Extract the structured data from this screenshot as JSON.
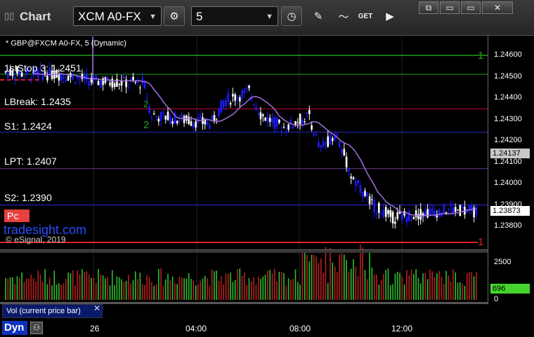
{
  "window": {
    "title": "Chart",
    "minimize_glyph": "⧉",
    "restore_glyph": "▭",
    "close_glyph": "✕"
  },
  "toolbar": {
    "symbol": "XCM A0-FX",
    "interval": "5",
    "get_label": "GET",
    "icons": [
      "gear-icon",
      "clock-icon",
      "pencil-icon",
      "chart-style-icon",
      "get-data-icon",
      "play-icon"
    ]
  },
  "chart": {
    "header": "* GBP@FXCM A0-FX, 5 (Dynamic)",
    "levels": [
      {
        "label": "1stStop 3: 1.2451",
        "price": 1.2451
      },
      {
        "label": "LBreak: 1.2435",
        "price": 1.2435
      },
      {
        "label": "S1: 1.2424",
        "price": 1.2424
      },
      {
        "label": "LPT: 1.2407",
        "price": 1.2407
      },
      {
        "label": "S2: 1.2390",
        "price": 1.239
      }
    ],
    "pc_label": "Pc",
    "watermark": "tradesight.com",
    "copyright": "© eSignal, 2019",
    "marker_1_top": "1",
    "marker_1_bottom": "1",
    "marker_2": "2",
    "marker_2b": "2",
    "price_axis": [
      "1.24600",
      "1.24500",
      "1.24400",
      "1.24300",
      "1.24200",
      "1.24100",
      "1.24000",
      "1.23900",
      "1.23800"
    ],
    "current_price": "1.23873",
    "ma_price": "1.24137",
    "colors": {
      "up": "#ffffff",
      "down": "#1a1aff",
      "ma": "#a070e0",
      "level": "#c8003c",
      "green": "#1fa01f"
    }
  },
  "volume": {
    "label": "Vol (current price bar)",
    "axis": [
      "2500",
      "0"
    ],
    "current_value": "696"
  },
  "time_axis": {
    "mode": "Dyn",
    "labels": [
      "26",
      "04:00",
      "08:00",
      "12:00"
    ]
  }
}
